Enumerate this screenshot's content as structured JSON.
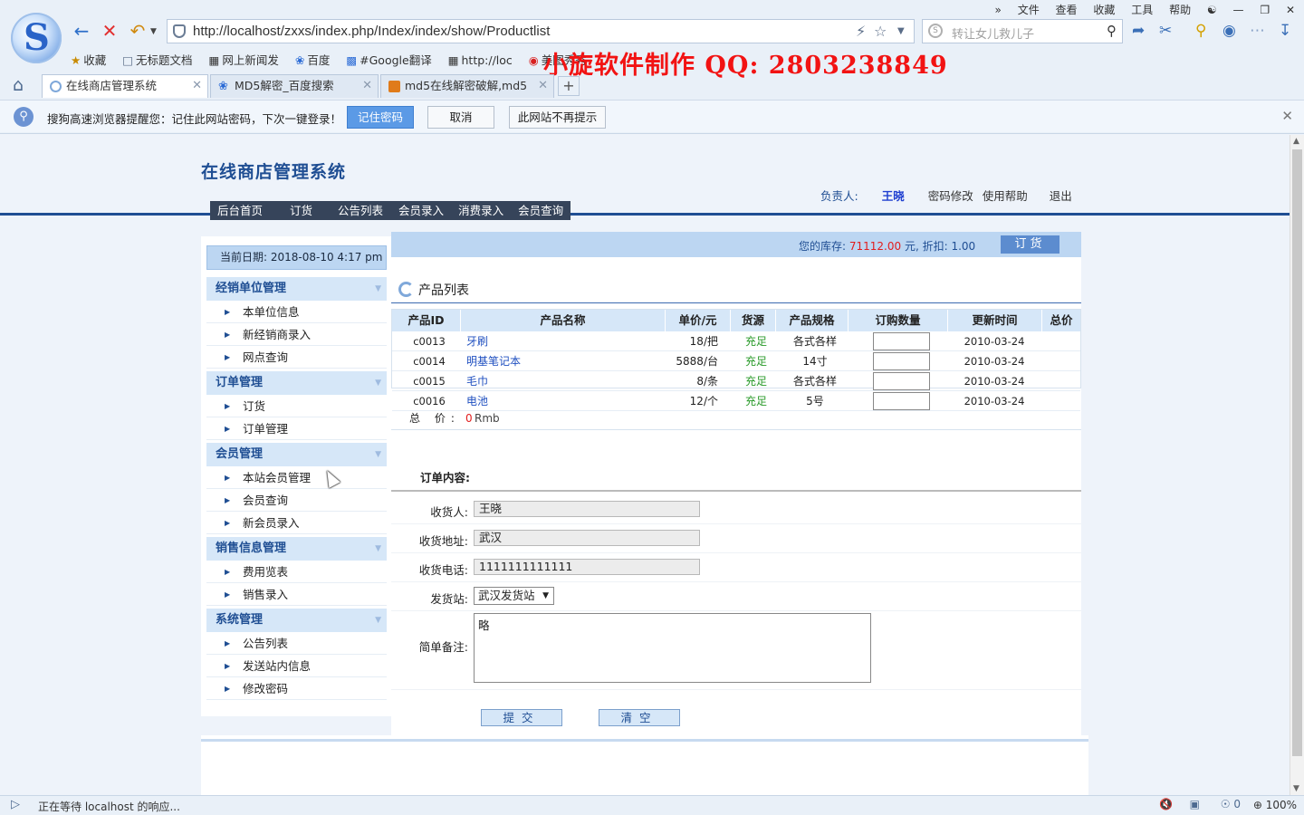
{
  "browser": {
    "menu": [
      "文件",
      "查看",
      "收藏",
      "工具",
      "帮助"
    ],
    "url": "http://localhost/zxxs/index.php/Index/index/show/Productlist",
    "search_placeholder": "转让女儿救儿子",
    "bookmarks": [
      "收藏",
      "无标题文档",
      "网上新闻发",
      "百度",
      "#Google翻译",
      "http://loc",
      "美图秀秀"
    ],
    "watermark": "小旋软件制作 QQ: 2803238849",
    "tabs": [
      {
        "label": "在线商店管理系统",
        "active": true
      },
      {
        "label": "MD5解密_百度搜索",
        "active": false
      },
      {
        "label": "md5在线解密破解,md5",
        "active": false
      }
    ],
    "password_bar": {
      "message": "搜狗高速浏览器提醒您：记住此网站密码，下次一键登录！",
      "save": "记住密码",
      "cancel": "取消",
      "never": "此网站不再提示"
    },
    "status": "正在等待 localhost 的响应...",
    "status_count": "0",
    "zoom": "100%"
  },
  "site": {
    "title": "在线商店管理系统",
    "manager_label": "负责人:",
    "manager_name": "王晓",
    "links": {
      "change_password": "密码修改",
      "help": "使用帮助",
      "logout": "退出"
    },
    "nav": [
      "后台首页",
      "订货",
      "公告列表",
      "会员录入",
      "消费录入",
      "会员查询"
    ]
  },
  "sidebar": {
    "date": "当前日期: 2018-08-10 4:17 pm",
    "groups": [
      {
        "title": "经销单位管理",
        "items": [
          "本单位信息",
          "新经销商录入",
          "网点查询"
        ]
      },
      {
        "title": "订单管理",
        "items": [
          "订货",
          "订单管理"
        ]
      },
      {
        "title": "会员管理",
        "items": [
          "本站会员管理",
          "会员查询",
          "新会员录入"
        ]
      },
      {
        "title": "销售信息管理",
        "items": [
          "费用览表",
          "销售录入"
        ]
      },
      {
        "title": "系统管理",
        "items": [
          "公告列表",
          "发送站内信息",
          "修改密码"
        ]
      }
    ]
  },
  "stock": {
    "label": "您的库存: ",
    "amount": "71112.00",
    "unit": " 元, 折扣: ",
    "discount": "1.00",
    "order_button": "订货"
  },
  "product_list": {
    "title": "产品列表",
    "columns": [
      "产品ID",
      "产品名称",
      "单价/元",
      "货源",
      "产品规格",
      "订购数量",
      "更新时间",
      "总价"
    ],
    "rows": [
      {
        "id": "c0013",
        "name": "牙刷",
        "price": "18/把",
        "stock": "充足",
        "spec": "各式各样",
        "updated": "2010-03-24"
      },
      {
        "id": "c0014",
        "name": "明基笔记本",
        "price": "5888/台",
        "stock": "充足",
        "spec": "14寸",
        "updated": "2010-03-24"
      },
      {
        "id": "c0015",
        "name": "毛巾",
        "price": "8/条",
        "stock": "充足",
        "spec": "各式各样",
        "updated": "2010-03-24"
      },
      {
        "id": "c0016",
        "name": "电池",
        "price": "12/个",
        "stock": "充足",
        "spec": "5号",
        "updated": "2010-03-24"
      }
    ],
    "total_label": "总 价:",
    "total_value": "0",
    "total_unit": "Rmb"
  },
  "order": {
    "title": "订单内容:",
    "receiver_label": "收货人:",
    "receiver": "王晓",
    "address_label": "收货地址:",
    "address": "武汉",
    "phone_label": "收货电话:",
    "phone": "1111111111111",
    "station_label": "发货站:",
    "station": "武汉发货站",
    "note_label": "简单备注:",
    "note": "略",
    "submit": "提交",
    "clear": "清空"
  }
}
